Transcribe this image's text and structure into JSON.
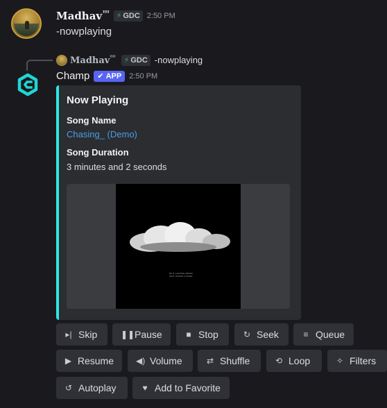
{
  "message": {
    "author": "Madhav",
    "author_sup": "ᴵᴵᴵᴵ",
    "guild_tag": "GDC",
    "time": "2:50 PM",
    "content": "-nowplaying"
  },
  "reply": {
    "author": "Madhav",
    "author_sup": "ᴵᴵᴵᴵ",
    "guild_tag": "GDC",
    "content": "-nowplaying"
  },
  "bot": {
    "name": "Champ",
    "badge": "APP",
    "time": "2:50 PM",
    "brand_color": "#1fd6d6"
  },
  "embed": {
    "accent_color": "#2ee6e6",
    "title": "Now Playing",
    "fields": [
      {
        "name": "Song Name",
        "value": "Chasing_ (Demo)"
      },
      {
        "name": "Song Duration",
        "value": "3 minutes and 2 seconds"
      }
    ],
    "image_caption": "MF ★ CHASING (DEMO)\nFEAT. RASHID & NAHEL"
  },
  "buttons": [
    {
      "label": "Skip",
      "icon": "skip-icon"
    },
    {
      "label": "Pause",
      "icon": "pause-icon"
    },
    {
      "label": "Stop",
      "icon": "stop-icon"
    },
    {
      "label": "Seek",
      "icon": "seek-icon"
    },
    {
      "label": "Queue",
      "icon": "queue-icon"
    },
    {
      "label": "Resume",
      "icon": "play-icon"
    },
    {
      "label": "Volume",
      "icon": "volume-icon"
    },
    {
      "label": "Shuffle",
      "icon": "shuffle-icon"
    },
    {
      "label": "Loop",
      "icon": "loop-icon"
    },
    {
      "label": "Filters",
      "icon": "wand-icon"
    },
    {
      "label": "Autoplay",
      "icon": "autoplay-icon"
    },
    {
      "label": "Add to Favorite",
      "icon": "heart-icon"
    }
  ]
}
